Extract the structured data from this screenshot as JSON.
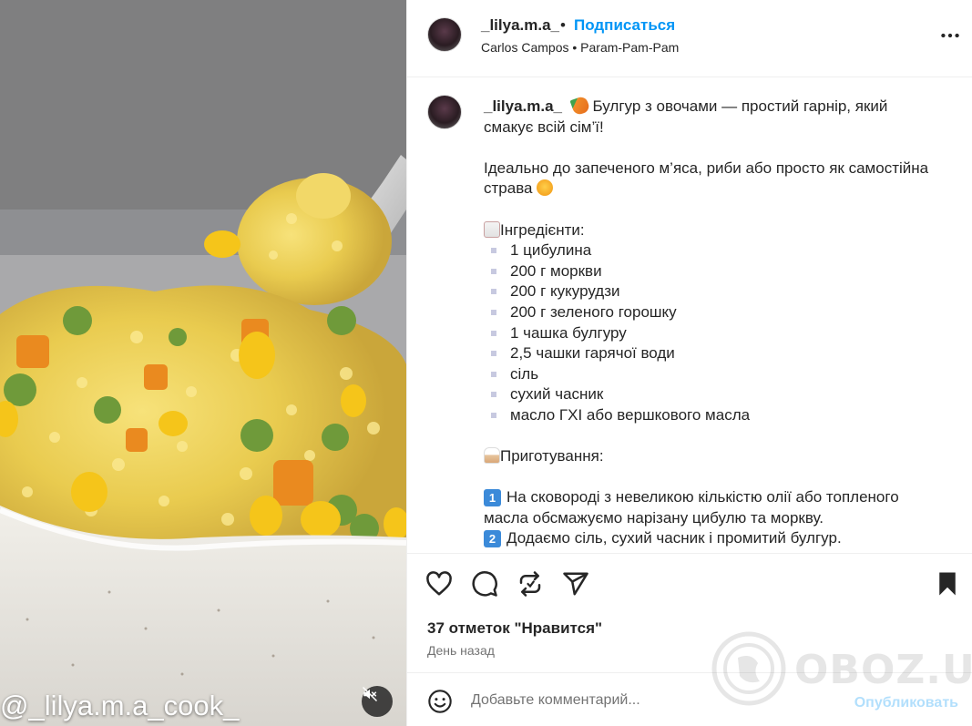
{
  "media": {
    "overlay_text": "@_lilya.m.a_cook_",
    "mute_icon": "muted-speaker-icon"
  },
  "post_header": {
    "username": "_lilya.m.a_",
    "separator": "•",
    "follow_label": "Подписаться",
    "music": "Carlos Campos • Param-Pam-Pam",
    "more_icon": "more-options-icon"
  },
  "caption": {
    "username": "_lilya.m.a_",
    "intro": "Булгур з овочами — простий гарнір, який смакує всій сім’ї!",
    "line2": "Ідеально до запеченого м’яса, риби або просто як самостійна страва",
    "ingredients_title": "Інгредієнти:",
    "ingredients": [
      "1 цибулина",
      "200 г моркви",
      "200 г кукурудзи",
      "200 г зеленого горошку",
      "1 чашка булгуру",
      "2,5 чашки гарячої води",
      "сіль",
      "сухий часник",
      "масло ГХІ або вершкового масла"
    ],
    "steps_title": "Приготування:",
    "steps": [
      {
        "num": "1",
        "text": "На сковороді з невеликою кількістю олії або топленого масла обсмажуємо нарізану цибулю та моркву."
      },
      {
        "num": "2",
        "text": "Додаємо сіль, сухий часник і промитий булгур."
      }
    ]
  },
  "actions": {
    "likes_text": "37 отметок \"Нравится\"",
    "time_ago": "День назад"
  },
  "comment": {
    "placeholder": "Добавьте комментарий...",
    "publish_label": "Опубликовать"
  },
  "watermark": {
    "site": "OBOZ.UA"
  },
  "colors": {
    "link_blue": "#0095f6",
    "publish_disabled": "#b2dffc",
    "text_primary": "#262626",
    "text_secondary": "#737373"
  }
}
